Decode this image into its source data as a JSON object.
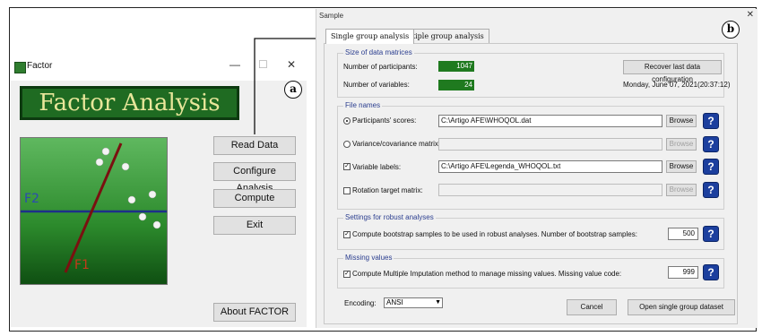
{
  "factor_window": {
    "title": "Factor",
    "minimize": "—",
    "maximize": "☐",
    "close": "✕",
    "logo_text": "Factor Analysis",
    "buttons": {
      "read_data": "Read Data",
      "configure": "Configure Analysis",
      "compute": "Compute",
      "exit": "Exit",
      "about": "About FACTOR"
    },
    "graphic_labels": {
      "f2": "F2",
      "f1": "F1"
    },
    "annotation": "a"
  },
  "sample_window": {
    "title": "Sample",
    "close": "✕",
    "annotation": "b",
    "tabs": [
      "Single group analysis",
      "Multiple group analysis"
    ],
    "size_group": {
      "label": "Size of data matrices",
      "participants_label": "Number of participants:",
      "participants_value": "1047",
      "variables_label": "Number of variables:",
      "variables_value": "24",
      "recover_button": "Recover last data configuration",
      "datetime": "Monday, June 07, 2021(20:37:12)"
    },
    "file_group": {
      "label": "File names",
      "rows": [
        {
          "label": "Participants' scores:",
          "value": "C:\\Artigo AFE\\WHOQOL.dat",
          "browse": "Browse",
          "enabled": true
        },
        {
          "label": "Variance/covariance matrix:",
          "value": "",
          "browse": "Browse",
          "enabled": false
        },
        {
          "label": "Variable labels:",
          "value": "C:\\Artigo AFE\\Legenda_WHOQOL.txt",
          "browse": "Browse",
          "enabled": true
        },
        {
          "label": "Rotation target matrix:",
          "value": "",
          "browse": "Browse",
          "enabled": false
        }
      ]
    },
    "robust_group": {
      "label": "Settings for robust analyses",
      "check_label": "Compute bootstrap samples to be used in robust analyses. Number of bootstrap samples:",
      "value": "500"
    },
    "missing_group": {
      "label": "Missing values",
      "check_label": "Compute Multiple Imputation method to manage missing values. Missing value code:",
      "value": "999"
    },
    "encoding_label": "Encoding:",
    "encoding_value": "ANSI",
    "cancel_button": "Cancel",
    "open_button": "Open single group dataset",
    "help_glyph": "?"
  }
}
